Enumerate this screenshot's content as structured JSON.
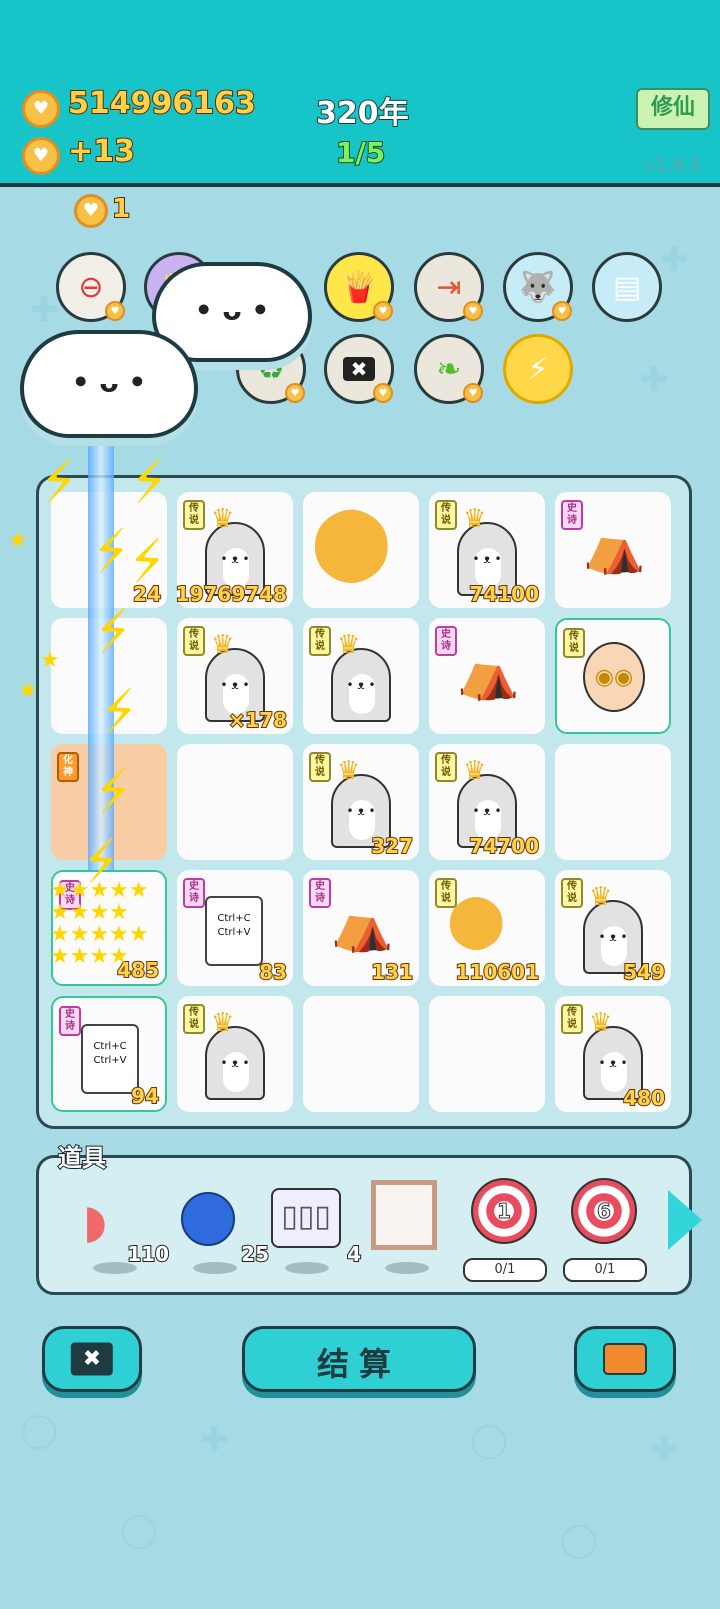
{
  "header": {
    "gold_total": "514996163",
    "gold_rate": "+13",
    "year": "320年",
    "progress": "1/5",
    "xiuxian_button": "修仙",
    "version": "v1.9.3",
    "floating_gain": "1"
  },
  "skills_row1": [
    "minus-coin-icon",
    "fries-icon",
    "fries-icon",
    "skip-forward-icon",
    "husky-icon",
    "skirt-icon"
  ],
  "skills_row2": [
    "recycle-icon",
    "cancel-tag-icon",
    "leaf-icon",
    "lightning-icon"
  ],
  "board": {
    "rows": [
      [
        {
          "kind": "effect",
          "count": "24"
        },
        {
          "kind": "husky",
          "tag": "传说",
          "count": "19769748"
        },
        {
          "kind": "coins",
          "tag": "",
          "count": ""
        },
        {
          "kind": "husky",
          "tag": "传说",
          "count": "74100"
        },
        {
          "kind": "house",
          "tag": "史诗",
          "count": ""
        }
      ],
      [
        {
          "kind": "effect",
          "count": ""
        },
        {
          "kind": "husky",
          "tag": "传说",
          "count": "×178"
        },
        {
          "kind": "husky",
          "tag": "传说",
          "count": ""
        },
        {
          "kind": "house",
          "tag": "史诗",
          "count": ""
        },
        {
          "kind": "bald",
          "tag": "传说",
          "count": ""
        }
      ],
      [
        {
          "kind": "effect-orange",
          "tag": "化神",
          "count": ""
        },
        {
          "kind": "empty",
          "tag": "",
          "count": ""
        },
        {
          "kind": "husky",
          "tag": "传说",
          "count": "327"
        },
        {
          "kind": "husky",
          "tag": "传说",
          "count": "74700"
        },
        {
          "kind": "empty",
          "tag": "",
          "count": ""
        }
      ],
      [
        {
          "kind": "effect-green",
          "tag": "史诗",
          "count": "485"
        },
        {
          "kind": "paper",
          "tag": "史诗",
          "count": "83"
        },
        {
          "kind": "house",
          "tag": "史诗",
          "count": "131"
        },
        {
          "kind": "husky",
          "tag": "传说",
          "count": "110601"
        },
        {
          "kind": "husky",
          "tag": "传说",
          "count": "549"
        }
      ],
      [
        {
          "kind": "paper-green",
          "tag": "史诗",
          "count": "94"
        },
        {
          "kind": "husky",
          "tag": "传说",
          "count": ""
        },
        {
          "kind": "empty",
          "tag": "",
          "count": ""
        },
        {
          "kind": "empty",
          "tag": "",
          "count": ""
        },
        {
          "kind": "husky",
          "tag": "传说",
          "count": "480"
        }
      ]
    ],
    "paper_text": [
      "Ctrl+C",
      "Ctrl+V"
    ]
  },
  "items": {
    "label": "道具",
    "list": [
      {
        "name": "liver-icon",
        "count": "110"
      },
      {
        "name": "blue-ball-icon",
        "count": "25"
      },
      {
        "name": "triple-slot-icon",
        "count": "4"
      },
      {
        "name": "frame-icon",
        "count": ""
      }
    ],
    "targets": [
      {
        "level": "1",
        "progress": "0/1"
      },
      {
        "level": "6",
        "progress": "0/1"
      }
    ]
  },
  "bottom": {
    "settle_label": "结算"
  }
}
